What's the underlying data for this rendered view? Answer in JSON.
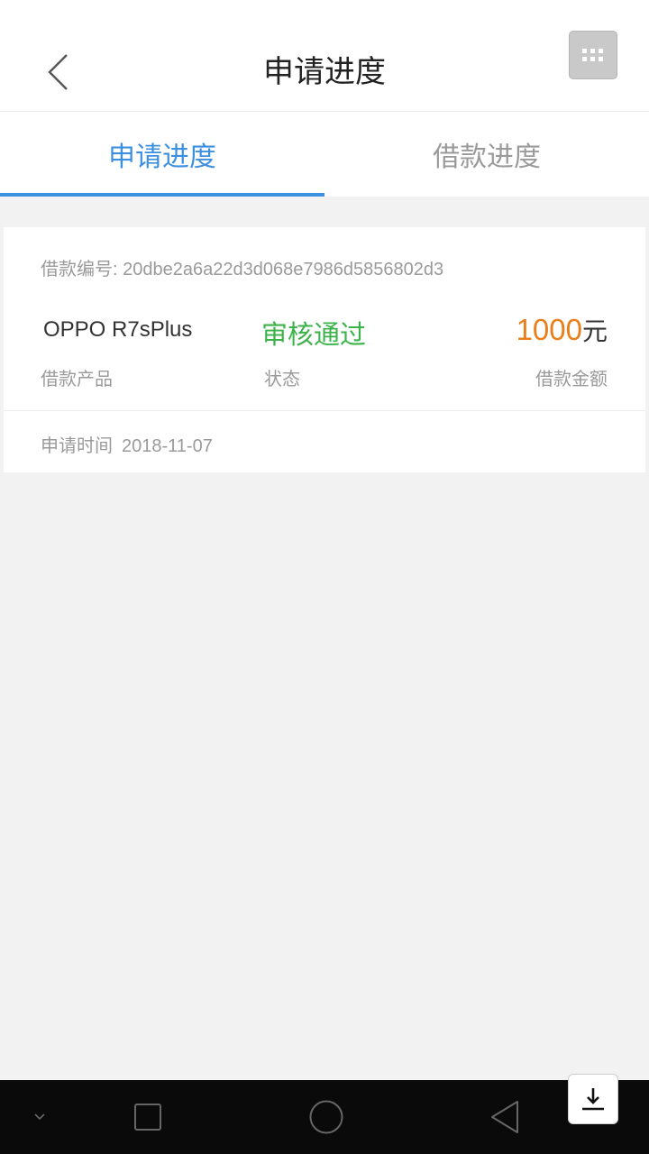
{
  "header": {
    "title": "申请进度",
    "back_icon": "chevron-left-icon",
    "menu_icon": "grid-dots-icon"
  },
  "tabs": [
    {
      "label": "申请进度",
      "active": true
    },
    {
      "label": "借款进度",
      "active": false
    }
  ],
  "card": {
    "loan_id_label": "借款编号:",
    "loan_id": "20dbe2a6a22d3d068e7986d5856802d3",
    "product_name": "OPPO R7sPlus",
    "status": "审核通过",
    "amount": "1000",
    "amount_unit": "元",
    "product_label": "借款产品",
    "status_label": "状态",
    "amount_label": "借款金额",
    "apply_time_label": "申请时间",
    "apply_time": "2018-11-07"
  },
  "colors": {
    "accent": "#3d8fe0",
    "status_success": "#3cb34a",
    "amount": "#e87f1a"
  },
  "system_nav": {
    "items": [
      "chevron-down-icon",
      "square-icon",
      "circle-icon",
      "triangle-back-icon"
    ],
    "floating_icon": "download-icon"
  }
}
